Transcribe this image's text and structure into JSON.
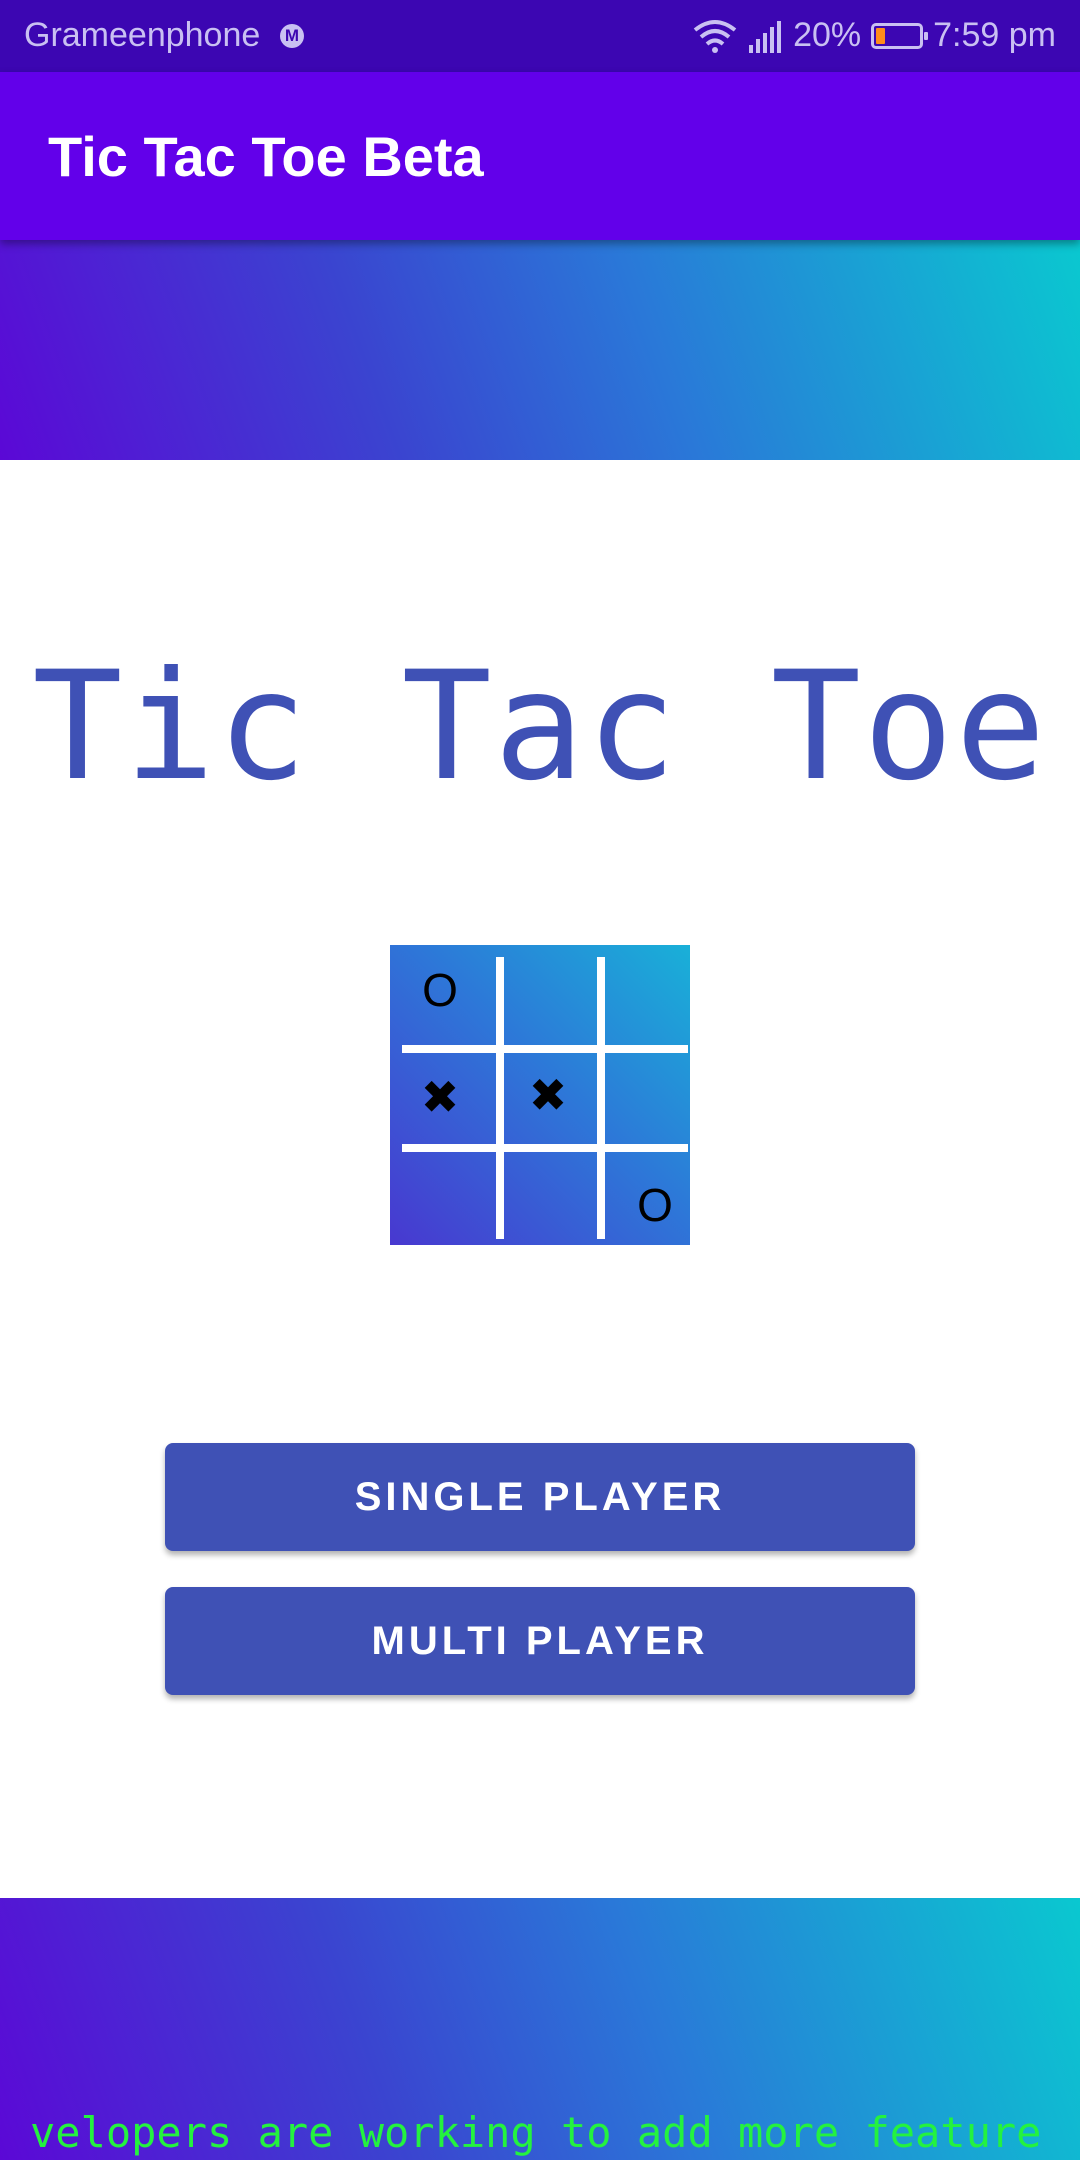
{
  "status_bar": {
    "carrier": "Grameenphone",
    "carrier_badge": "M",
    "battery_percent": "20%",
    "battery_level": 0.2,
    "time": "7:59 pm",
    "icons": [
      "wifi-icon",
      "signal-icon",
      "battery-icon"
    ]
  },
  "app_bar": {
    "title": "Tic Tac Toe Beta"
  },
  "main": {
    "title": "Tic Tac Toe",
    "board": {
      "cells": [
        "O",
        "",
        "",
        "✖",
        "✖",
        "",
        "",
        "",
        "O"
      ]
    },
    "single_player_label": "SINGLE PLAYER",
    "multi_player_label": "MULTI PLAYER"
  },
  "footer": {
    "ticker_text": "velopers are working to add more feature"
  },
  "colors": {
    "status_bar_bg": "#3c06b2",
    "app_bar_bg": "#6200ea",
    "primary": "#3f51b5",
    "ticker_text": "#24f23f"
  }
}
